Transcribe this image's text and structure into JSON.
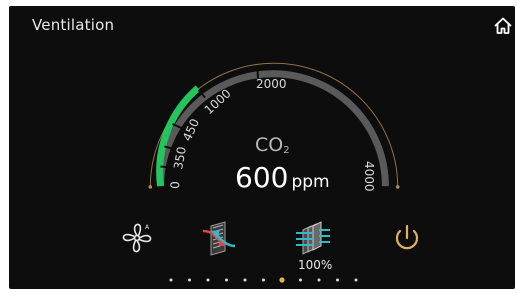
{
  "header": {
    "title": "Ventilation",
    "home_icon": "home-icon"
  },
  "gauge": {
    "min": 0,
    "max": 4000,
    "value": 600,
    "tick_labels": [
      "0",
      "350",
      "450",
      "1000",
      "2000",
      "4000"
    ],
    "label": "CO",
    "label_sub": "2",
    "reading_value": "600",
    "reading_unit": "ppm",
    "colors": {
      "active": "#22c55e",
      "track": "#5a5a5a",
      "outline": "#b58a52"
    }
  },
  "controls": [
    {
      "name": "fan-mode",
      "icon": "fan-icon"
    },
    {
      "name": "heat-recovery",
      "icon": "heat-exchange-icon",
      "colors": [
        "#e0434f",
        "#2fb9c9"
      ]
    },
    {
      "name": "filter-airflow",
      "icon": "filter-airflow-icon",
      "label": "100%"
    },
    {
      "name": "power",
      "icon": "power-icon",
      "color": "#e0b25e"
    }
  ],
  "pager": {
    "count": 11,
    "active_index": 6,
    "active_color": "#e0b25e"
  }
}
